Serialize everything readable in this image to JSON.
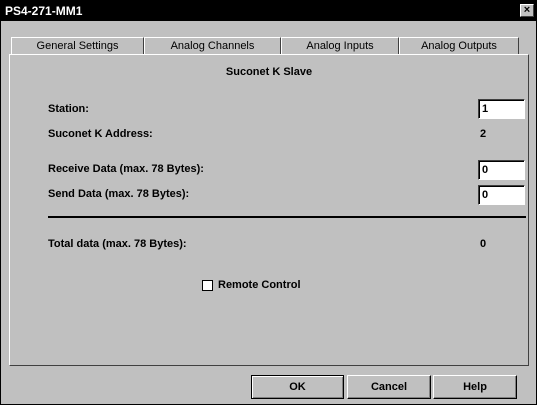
{
  "window": {
    "title": "PS4-271-MM1",
    "close_glyph": "×"
  },
  "tabs": [
    {
      "label": "General Settings"
    },
    {
      "label": "Analog Channels"
    },
    {
      "label": "Analog Inputs"
    },
    {
      "label": "Analog Outputs"
    }
  ],
  "panel": {
    "title": "Suconet K Slave",
    "station_label": "Station:",
    "station_value": "1",
    "address_label": "Suconet K Address:",
    "address_value": "2",
    "receive_label": "Receive Data (max. 78 Bytes):",
    "receive_value": "0",
    "send_label": "Send Data (max. 78 Bytes):",
    "send_value": "0",
    "total_label": "Total data (max. 78 Bytes):",
    "total_value": "0",
    "remote_label": "Remote Control",
    "remote_checked": false
  },
  "buttons": {
    "ok": "OK",
    "cancel": "Cancel",
    "help": "Help"
  }
}
